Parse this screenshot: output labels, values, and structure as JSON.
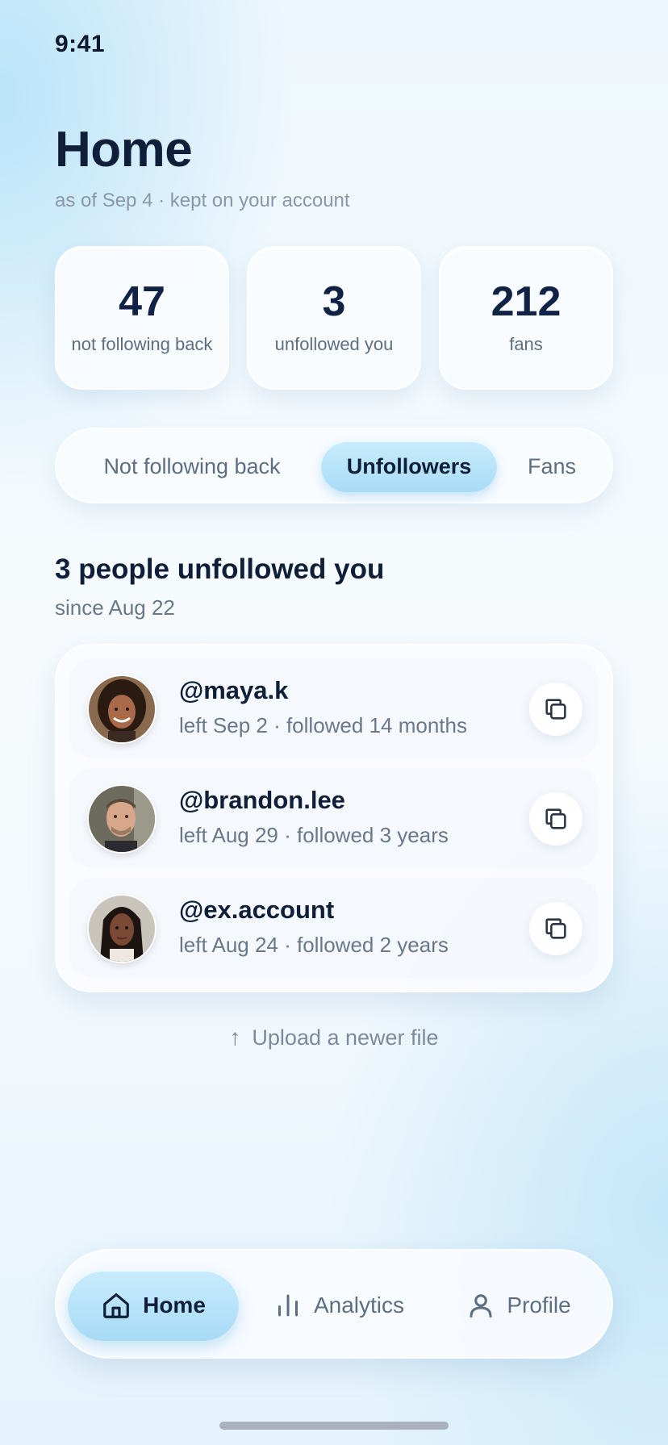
{
  "status_bar": {
    "time": "9:41"
  },
  "header": {
    "title": "Home",
    "subtitle": "as of Sep 4 · kept on your account"
  },
  "stats": [
    {
      "value": "47",
      "label": "not following back"
    },
    {
      "value": "3",
      "label": "unfollowed you"
    },
    {
      "value": "212",
      "label": "fans"
    }
  ],
  "segments": {
    "items": [
      "Not following back",
      "Unfollowers",
      "Fans"
    ],
    "selected": "Unfollowers"
  },
  "section": {
    "title": "3 people unfollowed you",
    "subtitle": "since Aug 22"
  },
  "unfollowers": [
    {
      "handle": "@maya.k",
      "meta": "left Sep 2 · followed 14 months",
      "action_icon": "copy-icon"
    },
    {
      "handle": "@brandon.lee",
      "meta": "left Aug 29 · followed 3 years",
      "action_icon": "copy-icon"
    },
    {
      "handle": "@ex.account",
      "meta": "left Aug 24 · followed 2 years",
      "action_icon": "copy-icon"
    }
  ],
  "upload": {
    "label": "Upload a newer file",
    "icon": "arrow-up-icon"
  },
  "tabbar": {
    "home": "Home",
    "analytics": "Analytics",
    "profile": "Profile",
    "selected": "Home"
  },
  "colors": {
    "accent": "#b5e2f8",
    "text_primary": "#0f1f3a",
    "text_secondary": "#6b7889"
  }
}
